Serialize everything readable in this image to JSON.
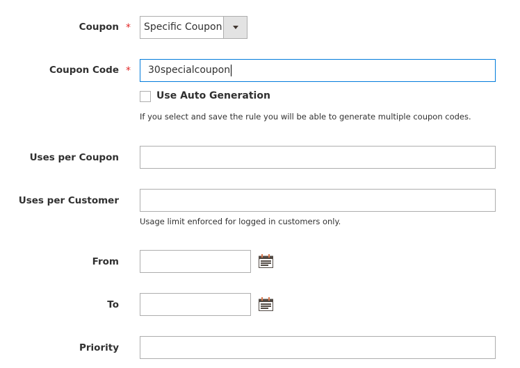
{
  "fields": {
    "coupon": {
      "label": "Coupon",
      "required": "*",
      "value": "Specific Coupon"
    },
    "coupon_code": {
      "label": "Coupon Code",
      "required": "*",
      "value": "30specialcoupon"
    },
    "auto_generation": {
      "label": "Use Auto Generation",
      "checked": false,
      "note": "If you select and save the rule you will be able to generate multiple coupon codes."
    },
    "uses_per_coupon": {
      "label": "Uses per Coupon",
      "value": ""
    },
    "uses_per_customer": {
      "label": "Uses per Customer",
      "value": "",
      "note": "Usage limit enforced for logged in customers only."
    },
    "from": {
      "label": "From",
      "value": "",
      "icon": "calendar-icon"
    },
    "to": {
      "label": "To",
      "value": "",
      "icon": "calendar-icon"
    },
    "priority": {
      "label": "Priority",
      "value": ""
    }
  },
  "colors": {
    "required": "#e22626",
    "focus_border": "#007bdb",
    "border": "#adadad"
  }
}
